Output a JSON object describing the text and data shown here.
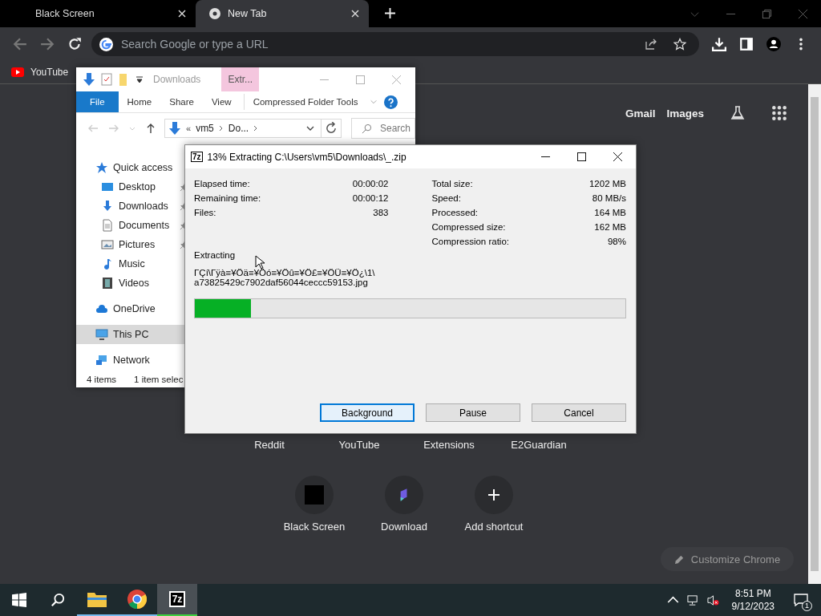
{
  "browser": {
    "tabs": [
      {
        "title": "Black Screen",
        "selected": false
      },
      {
        "title": "New Tab",
        "selected": true
      }
    ],
    "omnibox": {
      "placeholder": "Search Google or type a URL"
    },
    "bookmarks": [
      {
        "label": "YouTube"
      }
    ],
    "header_links": [
      "Gmail",
      "Images"
    ],
    "shortcut_rows": [
      [
        {
          "label": "Reddit",
          "kind": "covered"
        },
        {
          "label": "YouTube",
          "kind": "covered"
        },
        {
          "label": "Extensions",
          "kind": "covered"
        },
        {
          "label": "E2Guardian",
          "kind": "covered"
        }
      ],
      [
        {
          "label": "Black Screen",
          "kind": "black-square"
        },
        {
          "label": "Download",
          "kind": "app"
        },
        {
          "label": "Add shortcut",
          "kind": "add"
        }
      ]
    ],
    "customize_button": "Customize Chrome"
  },
  "explorer": {
    "title": "Downloads",
    "context_header": "Extr...",
    "ribbon_tabs": [
      {
        "label": "File",
        "kind": "file"
      },
      {
        "label": "Home",
        "kind": "tab"
      },
      {
        "label": "Share",
        "kind": "tab"
      },
      {
        "label": "View",
        "kind": "tab"
      },
      {
        "label": "Compressed Folder Tools",
        "kind": "context"
      }
    ],
    "breadcrumb_overflow": "«",
    "breadcrumb": [
      "vm5",
      "Do..."
    ],
    "search": {
      "placeholder": "Search"
    },
    "nav": [
      {
        "label": "Quick access",
        "kind": "star",
        "selected": false,
        "children": [
          {
            "label": "Desktop",
            "kind": "desktop",
            "selected": false,
            "pinned": true
          },
          {
            "label": "Downloads",
            "kind": "download",
            "selected": false,
            "pinned": true
          },
          {
            "label": "Documents",
            "kind": "documents",
            "selected": false,
            "pinned": true
          },
          {
            "label": "Pictures",
            "kind": "pictures",
            "selected": false,
            "pinned": true
          },
          {
            "label": "Music",
            "kind": "music",
            "selected": false,
            "pinned": false
          },
          {
            "label": "Videos",
            "kind": "videos",
            "selected": false,
            "pinned": false
          }
        ]
      },
      {
        "label": "OneDrive",
        "kind": "cloud",
        "selected": false
      },
      {
        "label": "This PC",
        "kind": "pc",
        "selected": true
      },
      {
        "label": "Network",
        "kind": "network",
        "selected": false
      }
    ],
    "status": [
      "4 items",
      "1 item selec"
    ]
  },
  "sevenzip": {
    "logo": "7z",
    "title": "13% Extracting C:\\Users\\vm5\\Downloads\\_.zip",
    "stats_left": [
      {
        "label": "Elapsed time:",
        "value": "00:00:02"
      },
      {
        "label": "Remaining time:",
        "value": "00:00:12"
      },
      {
        "label": "Files:",
        "value": "383"
      }
    ],
    "stats_right": [
      {
        "label": "Total size:",
        "value": "1202 MB"
      },
      {
        "label": "Speed:",
        "value": "80 MB/s"
      },
      {
        "label": "Processed:",
        "value": "164 MB"
      },
      {
        "label": "Compressed size:",
        "value": "162 MB"
      },
      {
        "label": "Compression ratio:",
        "value": "98%"
      }
    ],
    "status_label": "Extracting",
    "current_file": [
      "ΓÇí\\Γÿà≡¥Öä≡¥Öó≡¥Öû≡¥Ö£≡¥ÖÜ≡¥Ö¿\\1\\",
      "a73825429c7902daf56044ceccc59153.jpg"
    ],
    "progress": {
      "level": 0.13
    },
    "buttons": [
      {
        "label": "Background",
        "focused": true
      },
      {
        "label": "Pause",
        "focused": false
      },
      {
        "label": "Cancel",
        "focused": false
      }
    ]
  },
  "taskbar": {
    "apps": [
      {
        "kind": "explorer",
        "active": false
      },
      {
        "kind": "chrome",
        "active": false
      },
      {
        "kind": "sevenzip",
        "label": "7z",
        "active": true
      }
    ],
    "time": "8:51 PM",
    "date": "9/12/2023",
    "notifications": "1"
  }
}
